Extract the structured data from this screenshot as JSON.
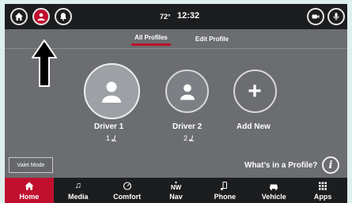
{
  "status_bar": {
    "temperature": "72°",
    "time": "12:32",
    "icons": [
      "home-icon",
      "profile-icon",
      "notification-bell-icon",
      "camera-icon",
      "microphone-icon"
    ]
  },
  "tabs": {
    "all_profiles": "All Profiles",
    "edit_profile": "Edit Profile"
  },
  "profiles": [
    {
      "name": "Driver 1",
      "seat": "1",
      "icon": "person-icon"
    },
    {
      "name": "Driver 2",
      "seat": "2",
      "icon": "person-icon"
    },
    {
      "name": "Add New",
      "icon": "plus-icon"
    }
  ],
  "valet_mode": "Valet Mode",
  "help": {
    "text": "What’s in a Profile?",
    "icon_glyph": "i"
  },
  "nav": [
    {
      "label": "Home",
      "icon": "home-icon",
      "active": true
    },
    {
      "label": "Media",
      "icon": "music-note-icon"
    },
    {
      "label": "Comfort",
      "icon": "climate-dial-icon"
    },
    {
      "label": "Nav",
      "icon": "compass-icon",
      "heading": "NW"
    },
    {
      "label": "Phone",
      "icon": "phone-icon"
    },
    {
      "label": "Vehicle",
      "icon": "car-icon"
    },
    {
      "label": "Apps",
      "icon": "apps-grid-icon"
    }
  ],
  "colors": {
    "accent": "#c0102e",
    "bar": "#1c1d1f",
    "panel": "#6b6d70"
  }
}
